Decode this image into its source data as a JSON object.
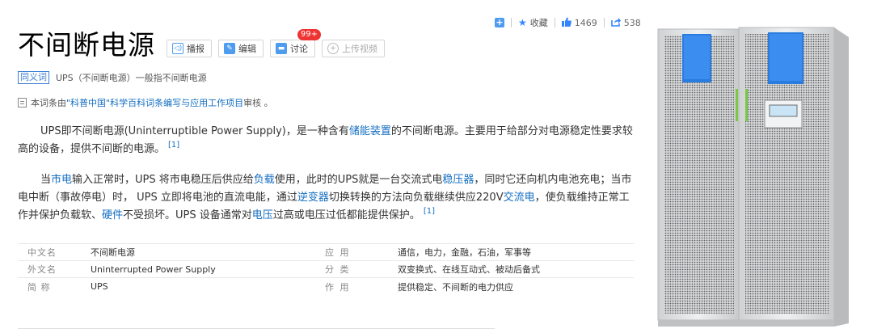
{
  "topbar": {
    "collect_label": "收藏",
    "like_count": "1469",
    "share_count": "538"
  },
  "title": "不间断电源",
  "title_buttons": {
    "play_label": "播报",
    "edit_label": "编辑",
    "discuss_label": "讨论",
    "discuss_badge": "99+",
    "upload_label": "上传视频"
  },
  "synonym": {
    "tag": "同义词",
    "text": "UPS（不间断电源）一般指不间断电源"
  },
  "audit": {
    "prefix": "本词条由",
    "link": "\"科普中国\"科学百科词条编写与应用工作项目",
    "suffix": " 审核 。"
  },
  "paragraph1": {
    "t1": "UPS即不间断电源(Uninterruptible Power Supply)，是一种含有",
    "l1": "储能装置",
    "t2": "的不间断电源。主要用于给部分对电源稳定性要求较高的设备，提供不间断的电源。",
    "ref": "[1]"
  },
  "paragraph2": {
    "t1": "当",
    "l1": "市电",
    "t2": "输入正常时，UPS 将市电稳压后供应给",
    "l2": "负载",
    "t3": "使用，此时的UPS就是一台交流式电",
    "l3": "稳压器",
    "t4": "，同时它还向机内电池充电；当市电中断（事故停电）时， UPS 立即将电池的直流电能，通过",
    "l4": "逆变器",
    "t5": "切换转换的方法向负载继续供应220V",
    "l5": "交流电",
    "t6": "，使负载维持正常工作并保护负载软、",
    "l6": "硬件",
    "t7": "不受损坏。UPS 设备通常对",
    "l7": "电压",
    "t8": "过高或电压过低都能提供保护。",
    "ref": "[1]"
  },
  "info_table": [
    {
      "k1": "中文名",
      "v1": "不间断电源",
      "k2": "应  用",
      "v2": "通信，电力，金融，石油，军事等"
    },
    {
      "k1": "外文名",
      "v1": "Uninterrupted Power Supply",
      "k2": "分  类",
      "v2": "双变换式、在线互动式、被动后备式"
    },
    {
      "k1": "简  称",
      "v1": "UPS",
      "k2": "作  用",
      "v2": "提供稳定、不间断的电力供应"
    }
  ],
  "colors": {
    "link": "#136ec2",
    "accent_blue": "#4f9cee",
    "badge_red": "#e33333",
    "cabinet_gray": "#e8e9ea",
    "cabinet_blue": "#2a7de0"
  }
}
